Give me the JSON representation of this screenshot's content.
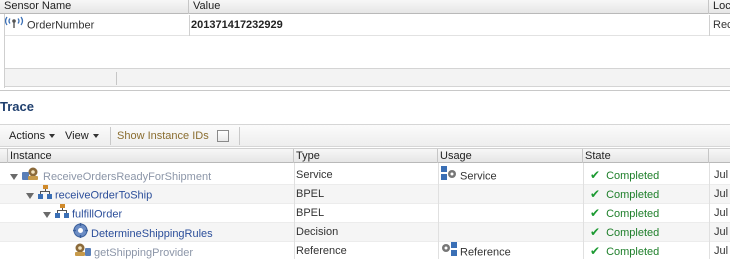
{
  "sensor": {
    "columns": [
      "Sensor Name",
      "Value",
      "Loca"
    ],
    "rows": [
      {
        "name": "OrderNumber",
        "value": "201371417232929",
        "location": "Rec"
      }
    ]
  },
  "trace": {
    "title": "Trace",
    "toolbar": {
      "actions": "Actions",
      "view": "View",
      "show_ids": "Show Instance IDs"
    },
    "columns": [
      "Instance",
      "Type",
      "Usage",
      "State"
    ],
    "rows": [
      {
        "instance": "ReceiveOrdersReadyForShipment",
        "type": "Service",
        "usage": "Service",
        "state": "Completed",
        "date": "Jul",
        "icon": "service-gear-icon"
      },
      {
        "instance": "receiveOrderToShip",
        "type": "BPEL",
        "usage": "",
        "state": "Completed",
        "date": "Jul",
        "icon": "bpel-process-icon"
      },
      {
        "instance": "fulfillOrder",
        "type": "BPEL",
        "usage": "",
        "state": "Completed",
        "date": "Jul",
        "icon": "bpel-process-icon"
      },
      {
        "instance": "DetermineShippingRules",
        "type": "Decision",
        "usage": "",
        "state": "Completed",
        "date": "Jul",
        "icon": "decision-rules-icon"
      },
      {
        "instance": "getShippingProvider",
        "type": "Reference",
        "usage": "Reference",
        "state": "Completed",
        "date": "Jul",
        "icon": "reference-gear-icon"
      }
    ]
  },
  "colors": {
    "link": "#2b4e9a",
    "link_grey": "#8c96a8",
    "completed": "#1e7f2a",
    "title": "#1f3f6e"
  }
}
